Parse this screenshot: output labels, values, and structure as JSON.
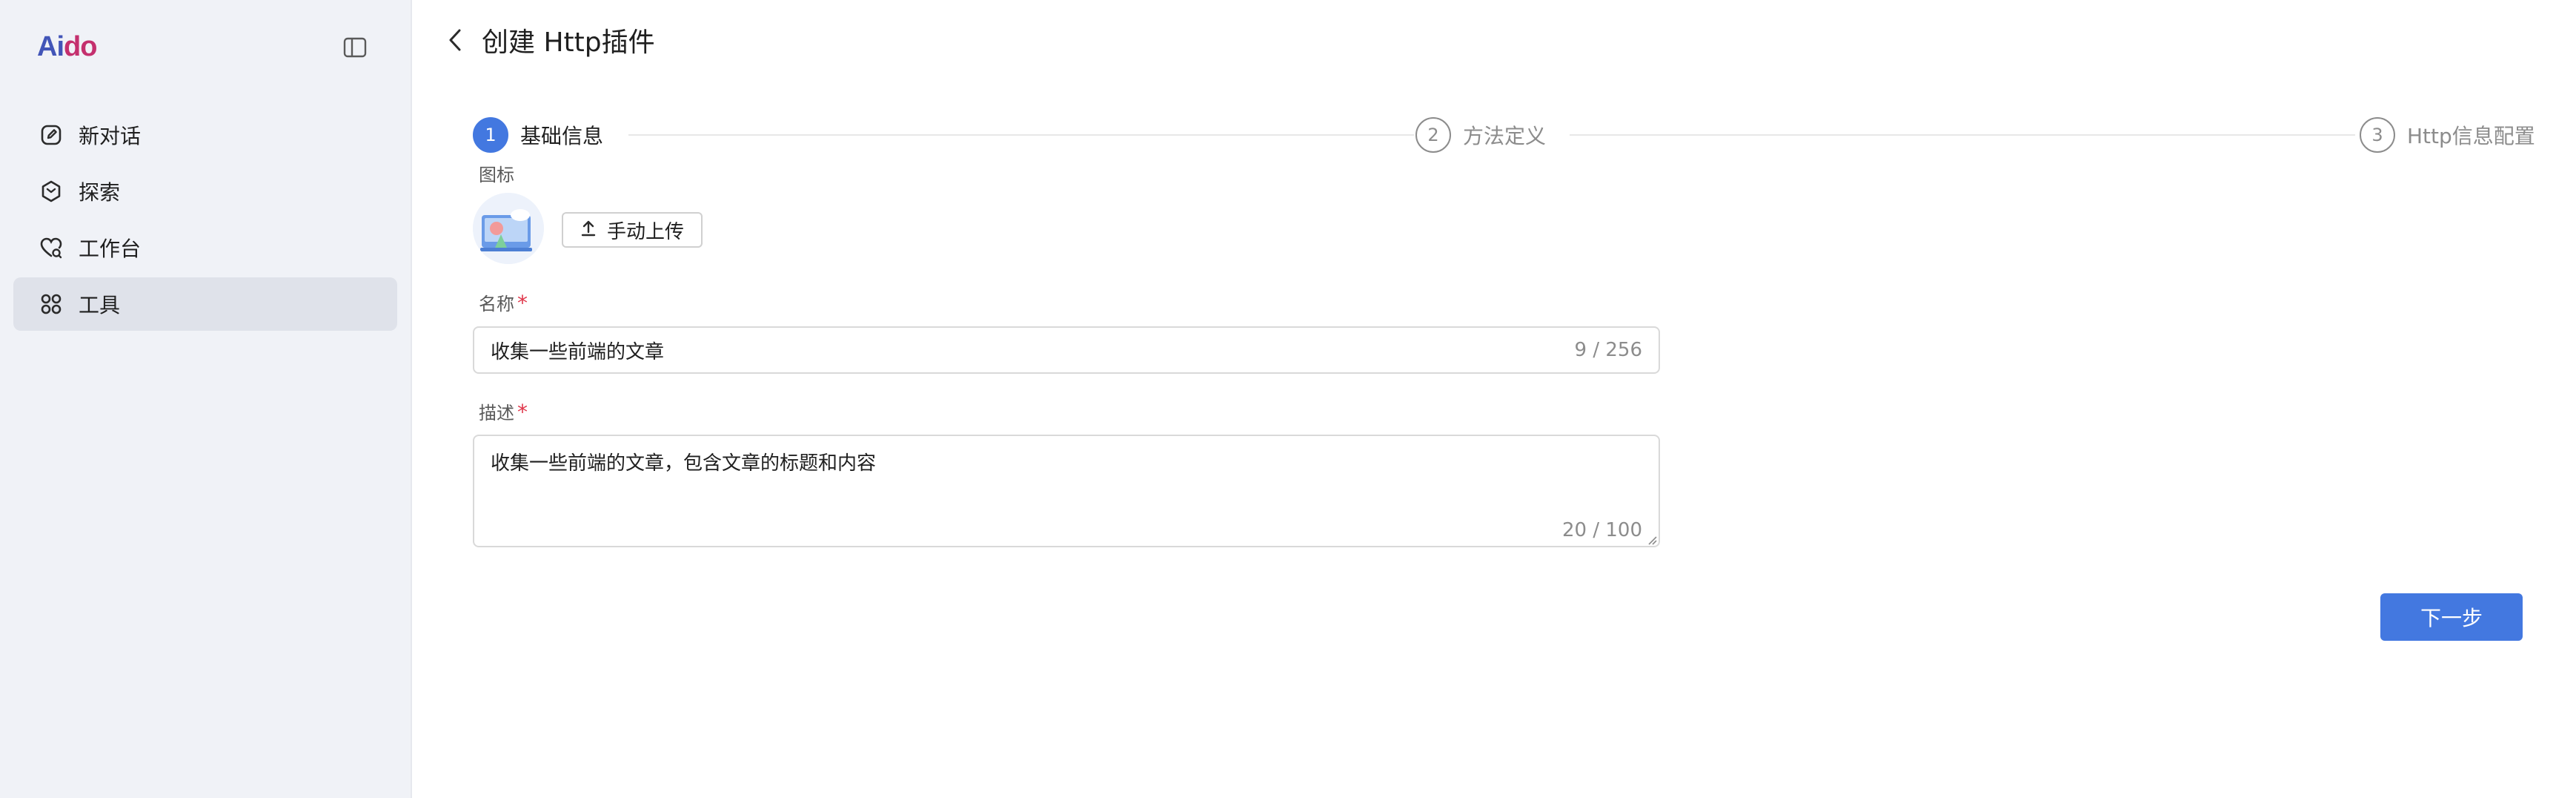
{
  "app": {
    "logo_a": "Ai",
    "logo_b": "do"
  },
  "sidebar": {
    "items": [
      {
        "label": "新对话",
        "icon": "edit-icon",
        "active": false
      },
      {
        "label": "探索",
        "icon": "compass-icon",
        "active": false
      },
      {
        "label": "工作台",
        "icon": "heart-chat-icon",
        "active": false
      },
      {
        "label": "工具",
        "icon": "apps-grid-icon",
        "active": true
      }
    ]
  },
  "header": {
    "title": "创建 Http插件"
  },
  "steps": [
    {
      "num": "1",
      "label": "基础信息",
      "active": true
    },
    {
      "num": "2",
      "label": "方法定义",
      "active": false
    },
    {
      "num": "3",
      "label": "Http信息配置",
      "active": false
    }
  ],
  "form": {
    "icon_label": "图标",
    "upload_label": "手动上传",
    "name_label": "名称",
    "name_value": "收集一些前端的文章",
    "name_count": "9 / 256",
    "desc_label": "描述",
    "desc_value": "收集一些前端的文章，包含文章的标题和内容",
    "desc_count": "20 / 100",
    "required_mark": "*"
  },
  "actions": {
    "next_label": "下一步"
  },
  "colors": {
    "primary": "#4378e0",
    "sidebar_bg": "#f0f2f7",
    "required": "#e0364a"
  }
}
